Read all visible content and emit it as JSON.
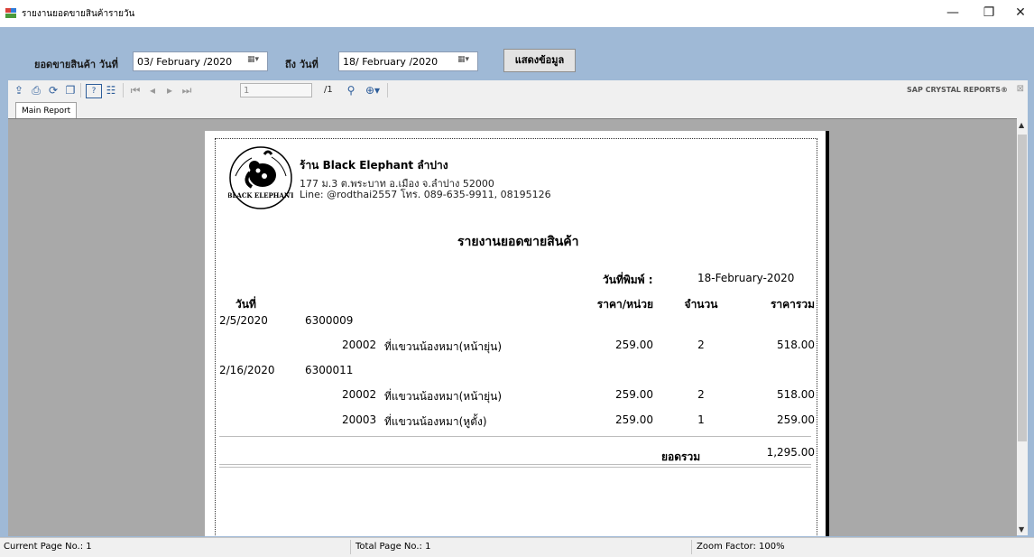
{
  "window": {
    "title": "รายงานยอดขายสินค้ารายวัน",
    "minimize": "—",
    "maximize": "❐",
    "close": "✕"
  },
  "filter": {
    "from_label": "ยอดขายสินค้า วันที่",
    "from_value": "03/ February /2020",
    "to_label": "ถึง วันที่",
    "to_value": "18/ February /2020",
    "show_button": "แสดงข้อมูล"
  },
  "toolbar": {
    "page_value": "1",
    "page_total": "/1",
    "brand": "SAP CRYSTAL REPORTS®"
  },
  "tabs": [
    "Main Report"
  ],
  "report": {
    "shop_name": "ร้าน Black Elephant ลำปาง",
    "address": "177 ม.3 ต.พระบาท อ.เมือง จ.ลำปาง 52000",
    "contact": "Line: @rodthai2557 โทร. 089-635-9911, 08195126",
    "logo_text": "BLACK ELEPHANT",
    "title": "รายงานยอดขายสินค้า",
    "print_label": "วันที่พิมพ์ :",
    "print_date": "18-February-2020",
    "headers": {
      "date": "วันที่",
      "price": "ราคา/หน่วย",
      "qty": "จำนวน",
      "total": "ราคารวม"
    },
    "groups": [
      {
        "date": "2/5/2020",
        "bill": "6300009",
        "items": [
          {
            "code": "20002",
            "name": "ที่แขวนน้องหมา(หน้ายุ่น)",
            "price": "259.00",
            "qty": "2",
            "total": "518.00"
          }
        ]
      },
      {
        "date": "2/16/2020",
        "bill": "6300011",
        "items": [
          {
            "code": "20002",
            "name": "ที่แขวนน้องหมา(หน้ายุ่น)",
            "price": "259.00",
            "qty": "2",
            "total": "518.00"
          },
          {
            "code": "20003",
            "name": "ที่แขวนน้องหมา(หูตั้ง)",
            "price": "259.00",
            "qty": "1",
            "total": "259.00"
          }
        ]
      }
    ],
    "grand_label": "ยอดรวม",
    "grand_total": "1,295.00"
  },
  "status": {
    "current_page": "Current Page No.: 1",
    "total_page": "Total Page No.: 1",
    "zoom": "Zoom Factor: 100%"
  }
}
